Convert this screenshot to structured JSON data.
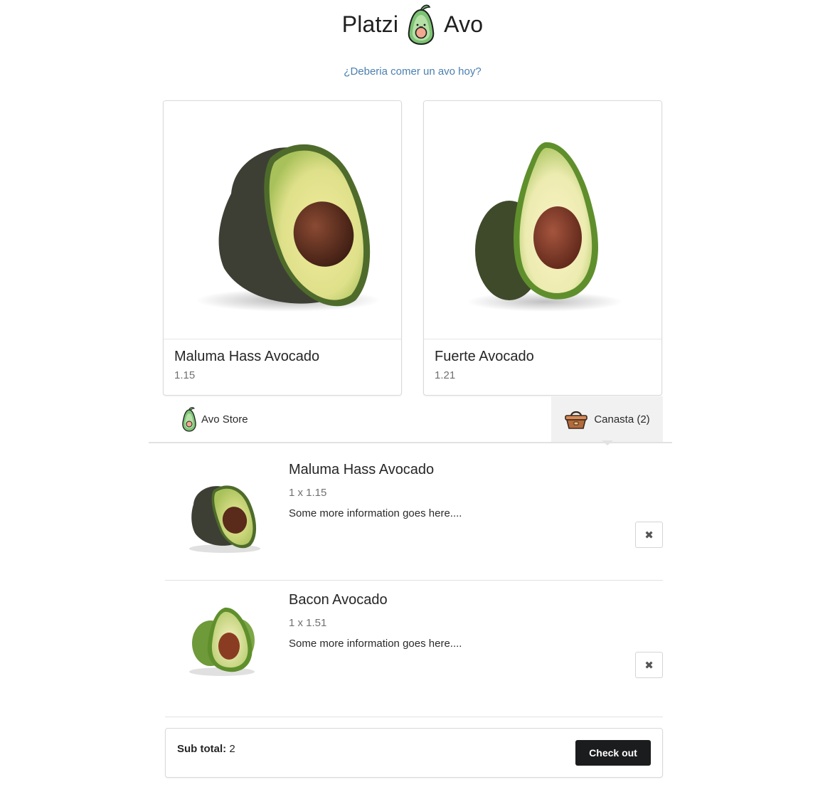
{
  "header": {
    "brand_left": "Platzi",
    "brand_right": "Avo",
    "logo_icon": "avocado-mascot-icon",
    "tagline": "¿Deberia comer un avo hoy?"
  },
  "products": [
    {
      "name": "Maluma Hass Avocado",
      "price": "1.15"
    },
    {
      "name": "Fuerte Avocado",
      "price": "1.21"
    }
  ],
  "menu": {
    "store_label": "Avo Store",
    "store_icon": "avocado-icon",
    "basket_label": "Canasta (2)",
    "basket_icon": "basket-icon"
  },
  "cart": {
    "items": [
      {
        "name": "Maluma Hass Avocado",
        "quantity_line": "1 x 1.15",
        "description": "Some more information goes here....",
        "remove_icon": "close-icon"
      },
      {
        "name": "Bacon Avocado",
        "quantity_line": "1 x 1.51",
        "description": "Some more information goes here....",
        "remove_icon": "close-icon"
      }
    ],
    "subtotal_label": "Sub total:",
    "subtotal_value": "2",
    "checkout_label": "Check out",
    "remove_glyph": "✖"
  },
  "colors": {
    "tagline": "#4b80b0",
    "checkout_button": "#1b1c1d",
    "basket_tab": "#f1f1f1"
  }
}
